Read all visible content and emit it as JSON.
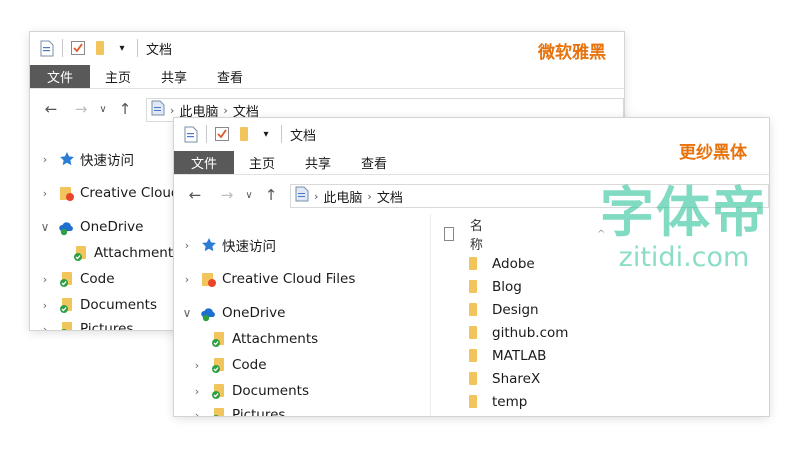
{
  "colors": {
    "accent_label": "#e8720c",
    "ribbon_file_bg": "#595959",
    "folder": "#f2c55c",
    "onedrive": "#1e6fd1",
    "sync_ok": "#2ea043",
    "watermark": "#2ec29a"
  },
  "window1": {
    "title": "文档",
    "font_label": "微软雅黑",
    "ribbon": {
      "file": "文件",
      "home": "主页",
      "share": "共享",
      "view": "查看"
    },
    "breadcrumb": {
      "pc": "此电脑",
      "folder": "文档"
    },
    "tree": {
      "quick_access": "快速访问",
      "creative_cloud": "Creative Cloud",
      "onedrive": "OneDrive",
      "attachments": "Attachments",
      "code": "Code",
      "documents": "Documents",
      "pictures": "Pictures"
    }
  },
  "window2": {
    "title": "文档",
    "font_label": "更纱黑体",
    "ribbon": {
      "file": "文件",
      "home": "主页",
      "share": "共享",
      "view": "查看"
    },
    "breadcrumb": {
      "pc": "此电脑",
      "folder": "文档"
    },
    "tree": {
      "quick_access": "快速访问",
      "creative_cloud": "Creative Cloud Files",
      "onedrive": "OneDrive",
      "attachments": "Attachments",
      "code": "Code",
      "documents": "Documents",
      "pictures": "Pictures"
    },
    "list": {
      "name_header": "名称",
      "items": [
        "Adobe",
        "Blog",
        "Design",
        "github.com",
        "MATLAB",
        "ShareX",
        "temp"
      ]
    }
  },
  "watermark": {
    "cn": "字体帝",
    "en": "zitidi.com"
  }
}
